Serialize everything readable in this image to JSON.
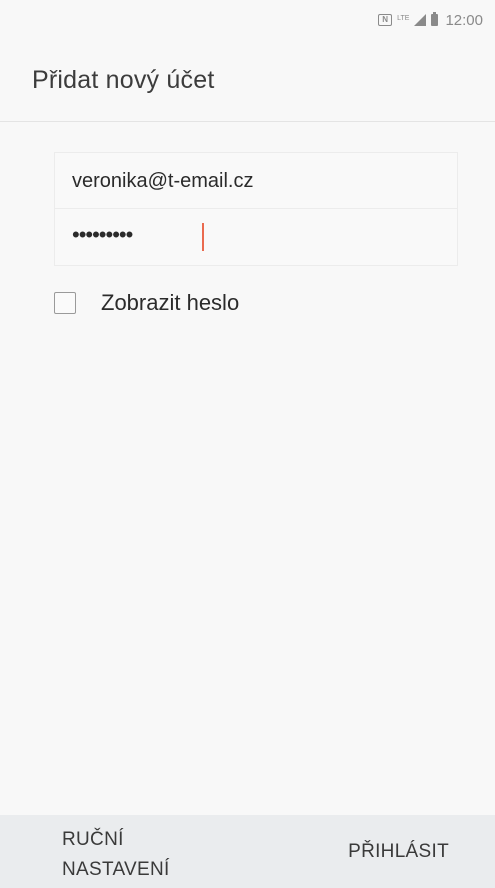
{
  "status_bar": {
    "nfc_icon": "N",
    "network_label": "LTE",
    "time": "12:00"
  },
  "header": {
    "title": "Přidat nový účet"
  },
  "form": {
    "email_value": "veronika@t-email.cz",
    "password_masked": "•••••••••"
  },
  "show_password": {
    "label": "Zobrazit heslo",
    "checked": false
  },
  "actions": {
    "manual_setup_line1": "RUČNÍ",
    "manual_setup_line2": "NASTAVENÍ",
    "sign_in_label": "PŘIHLÁSIT"
  },
  "colors": {
    "background": "#f8f8f8",
    "bottom_bar": "#eaecee",
    "cursor_accent": "#ea6a4f"
  }
}
